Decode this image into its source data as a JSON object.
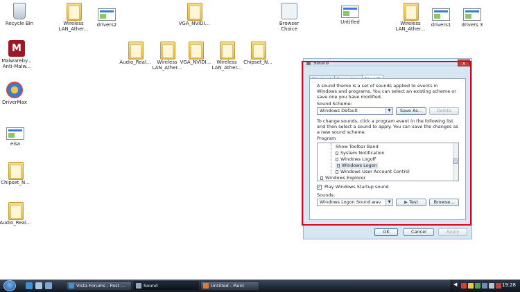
{
  "desktop": {
    "icons": [
      {
        "label": "Recycle Bin",
        "icon": "recycle-bin-icon"
      },
      {
        "label": "Wireless LAN_Ather...",
        "icon": "folder-icon"
      },
      {
        "label": "drivers2",
        "icon": "window-thumbnail-icon"
      },
      {
        "label": "VGA_NVIDI...",
        "icon": "folder-icon"
      },
      {
        "label": "Browser Choice",
        "icon": "browser-choice-icon"
      },
      {
        "label": "Untitled",
        "icon": "window-thumbnail-icon"
      },
      {
        "label": "Wireless LAN_Ather...",
        "icon": "folder-icon"
      },
      {
        "label": "drivers1",
        "icon": "window-thumbnail-icon"
      },
      {
        "label": "drivers 3",
        "icon": "window-thumbnail-icon"
      },
      {
        "label": "Malwareby... Anti-Malw...",
        "icon": "malwarebytes-icon"
      },
      {
        "label": "Audio_Real...",
        "icon": "folder-icon"
      },
      {
        "label": "Wireless LAN_Ather...",
        "icon": "folder-icon"
      },
      {
        "label": "VGA_NVIDI...",
        "icon": "folder-icon"
      },
      {
        "label": "Wireless LAN_Ather...",
        "icon": "folder-icon"
      },
      {
        "label": "Chipset_N...",
        "icon": "folder-icon"
      },
      {
        "label": "DriverMax",
        "icon": "drivermax-icon"
      },
      {
        "label": "eisa",
        "icon": "window-thumbnail-icon"
      },
      {
        "label": "Chipset_N...",
        "icon": "folder-icon"
      },
      {
        "label": "Audio_Real...",
        "icon": "folder-icon"
      }
    ]
  },
  "sound_dialog": {
    "title": "Sound",
    "close_label": "X",
    "tabs": [
      "Playback",
      "Recording",
      "Sounds"
    ],
    "active_tab": "Sounds",
    "intro_text": "A sound theme is a set of sounds applied to events in Windows and programs.  You can select an existing scheme or save one you have modified.",
    "scheme_label": "Sound Scheme:",
    "scheme_value": "Windows Default",
    "save_as_label": "Save As...",
    "delete_label": "Delete",
    "change_text": "To change sounds, click a program event in the following list and then select a sound to apply.  You can save the changes as a new sound scheme.",
    "program_label": "Program",
    "program_items": [
      "Show Toolbar Band",
      "System Notification",
      "Windows Logoff",
      "Windows Logon",
      "Windows User Account Control",
      "Windows Explorer"
    ],
    "selected_item": "Windows Logon",
    "startup_checkbox_label": "Play Windows Startup sound",
    "startup_checked": true,
    "sounds_label": "Sounds:",
    "sound_value": "Windows Logon Sound.wav",
    "test_label": "Test",
    "browse_label": "Browse...",
    "ok_label": "OK",
    "cancel_label": "Cancel",
    "apply_label": "Apply"
  },
  "taskbar": {
    "buttons": [
      {
        "label": "Vista Forums - Post ...",
        "icon": "ie-icon"
      },
      {
        "label": "Sound",
        "icon": "speaker-icon"
      },
      {
        "label": "Untitled - Paint",
        "icon": "paint-icon"
      }
    ],
    "active_button": "Sound",
    "clock": "19:28"
  },
  "colors": {
    "highlight_box": "#e0001b",
    "taskbar": "#1c2530"
  }
}
